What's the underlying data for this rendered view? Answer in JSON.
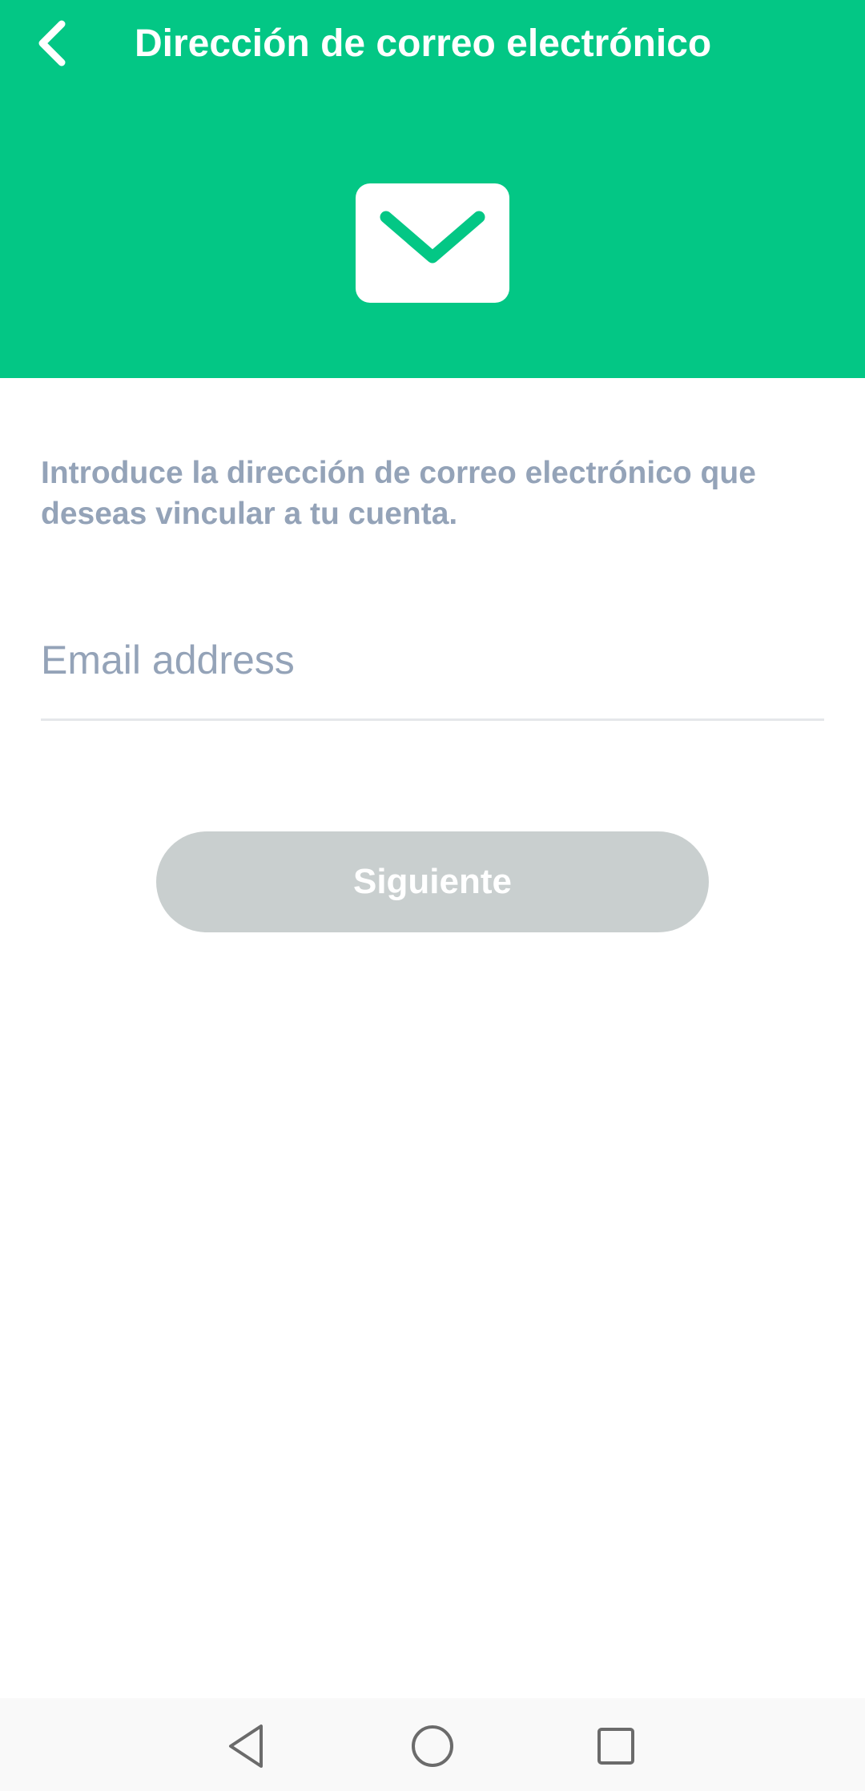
{
  "header": {
    "title": "Dirección de correo electrónico",
    "background_color": "#03c785",
    "back_icon": "chevron-left-icon",
    "hero_icon": "envelope-icon"
  },
  "main": {
    "intro_text": "Introduce la dirección de correo electrónico que\ndeseas vincular a tu cuenta.",
    "email_field": {
      "placeholder": "Email address",
      "value": ""
    },
    "next_button_label": "Siguiente",
    "next_button_state": "disabled",
    "next_button_color": "#c9cfcf"
  },
  "system_nav": {
    "back_icon": "triangle-back-icon",
    "home_icon": "circle-home-icon",
    "recents_icon": "square-recents-icon"
  }
}
